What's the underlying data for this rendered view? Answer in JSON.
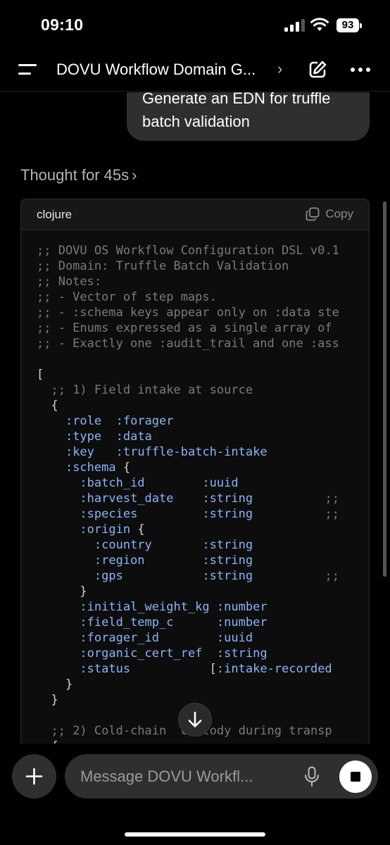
{
  "status_bar": {
    "time": "09:10",
    "battery": "93"
  },
  "header": {
    "title": "DOVU Workflow Domain G...",
    "title_chevron": "›",
    "menu_icon": "hamburger-menu-icon",
    "edit_icon": "compose-icon",
    "more_icon": "ellipsis-icon"
  },
  "chat": {
    "user_message": "Generate an EDN for truffle batch validation",
    "thought_label": "Thought for 45s",
    "thought_chevron": "›"
  },
  "code_block": {
    "language": "clojure",
    "copy_label": "Copy",
    "lines": [
      ";; DOVU OS Workflow Configuration DSL v0.1",
      ";; Domain: Truffle Batch Validation",
      ";; Notes:",
      ";; - Vector of step maps.",
      ";; - :schema keys appear only on :data ste",
      ";; - Enums expressed as a single array of",
      ";; - Exactly one :audit_trail and one :ass",
      "",
      "[",
      "  ;; 1) Field intake at source",
      "  {",
      "    :role  :forager",
      "    :type  :data",
      "    :key   :truffle-batch-intake",
      "    :schema {",
      "      :batch_id        :uuid",
      "      :harvest_date    :string          ;;",
      "      :species         :string          ;;",
      "      :origin {",
      "        :country       :string",
      "        :region        :string",
      "        :gps           :string          ;;",
      "      }",
      "      :initial_weight_kg :number",
      "      :field_temp_c      :number",
      "      :forager_id        :uuid",
      "      :organic_cert_ref  :string",
      "      :status           [:intake-recorded",
      "    }",
      "  }",
      "",
      "  ;; 2) Cold-chain  custody during transp",
      "  {"
    ]
  },
  "composer": {
    "placeholder": "Message DOVU Workfl...",
    "plus_icon": "plus-icon",
    "mic_icon": "microphone-icon",
    "stop_icon": "stop-icon"
  },
  "scroll_down_icon": "arrow-down-icon",
  "colors": {
    "background": "#000000",
    "bubble": "#2f2f2f",
    "code_keyword": "#8ab4f8",
    "code_comment": "#7a7a7a"
  }
}
